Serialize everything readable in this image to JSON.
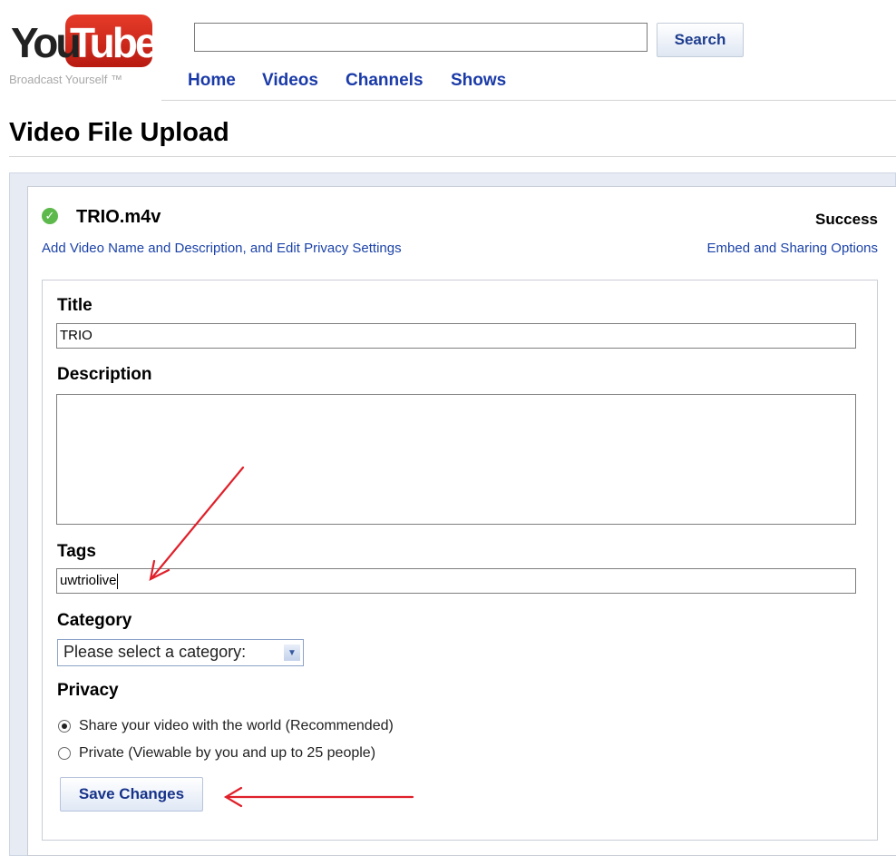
{
  "header": {
    "logo": {
      "you": "You",
      "tube": "Tube"
    },
    "tagline": "Broadcast Yourself ™",
    "search": {
      "value": "",
      "button_label": "Search"
    },
    "nav": [
      "Home",
      "Videos",
      "Channels",
      "Shows"
    ],
    "colors": {
      "brand_red": "#cc2a1a",
      "link_blue": "#1a3aa8"
    }
  },
  "page_title": "Video File Upload",
  "upload": {
    "file_name": "TRIO.m4v",
    "status": "Success",
    "status_icon": "check-circle-icon",
    "left_link": "Add Video Name and Description, and Edit Privacy Settings",
    "right_link": "Embed and Sharing Options"
  },
  "form": {
    "title_label": "Title",
    "title_value": "TRIO",
    "description_label": "Description",
    "description_value": "",
    "tags_label": "Tags",
    "tags_value": "uwtriolive",
    "category_label": "Category",
    "category_selected": "Please select a category:",
    "privacy_label": "Privacy",
    "privacy_options": [
      {
        "label": "Share your video with the world (Recommended)",
        "selected": true
      },
      {
        "label": "Private (Viewable by you and up to 25 people)",
        "selected": false
      }
    ],
    "save_label": "Save Changes"
  },
  "annotations": {
    "arrow_color": "#e0202a"
  }
}
